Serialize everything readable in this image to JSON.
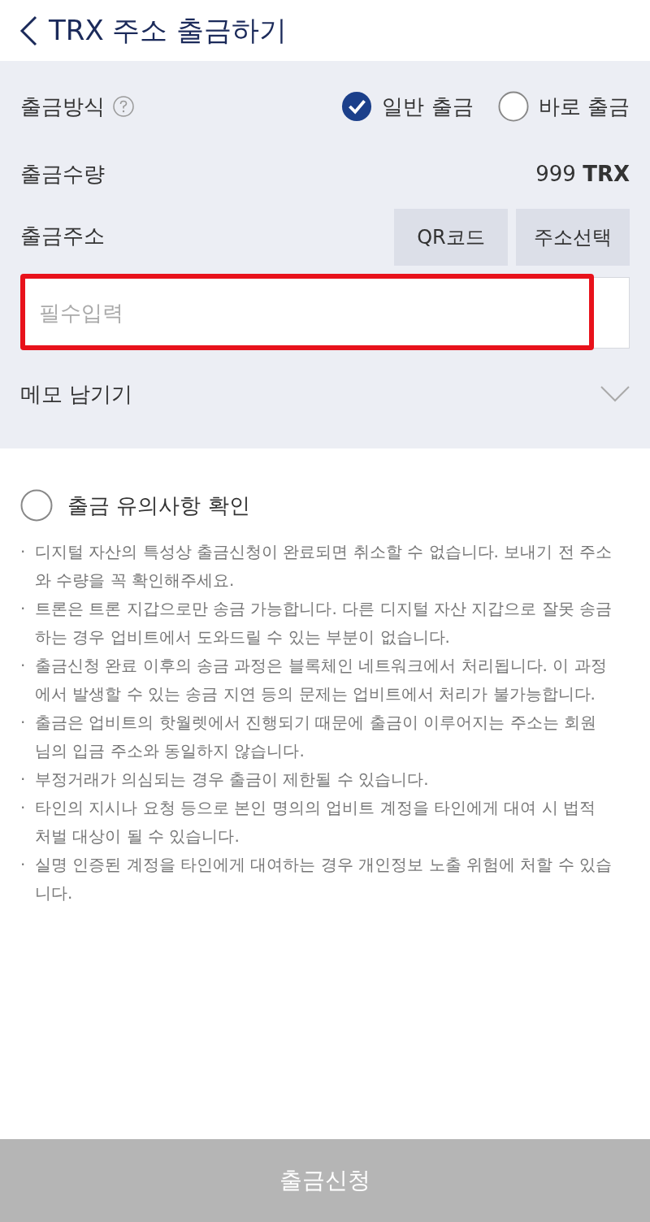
{
  "header": {
    "title": "TRX 주소 출금하기"
  },
  "method": {
    "label": "출금방식",
    "options": [
      {
        "label": "일반 출금",
        "selected": true
      },
      {
        "label": "바로 출금",
        "selected": false
      }
    ]
  },
  "amount": {
    "label": "출금수량",
    "value": "999",
    "unit": "TRX"
  },
  "address": {
    "label": "출금주소",
    "buttons": [
      "QR코드",
      "주소선택"
    ],
    "placeholder": "필수입력"
  },
  "memo": {
    "label": "메모 남기기",
    "expanded": false
  },
  "confirm": {
    "label": "출금 유의사항 확인",
    "checked": false
  },
  "notes": [
    {
      "bullet": "·",
      "text": "디지털 자산의 특성상 출금신청이 완료되면 취소할 수 없습니다. 보내기 전 주소와 수량을 꼭 확인해주세요."
    },
    {
      "bullet": "·",
      "text": "트론은 트론 지갑으로만 송금 가능합니다. 다른 디지털 자산 지갑으로 잘못 송금하는 경우 업비트에서 도와드릴 수 있는 부분이 없습니다."
    },
    {
      "bullet": "·",
      "text": "출금신청 완료 이후의 송금 과정은 블록체인 네트워크에서 처리됩니다. 이 과정에서 발생할 수 있는 송금 지연 등의 문제는 업비트에서 처리가 불가능합니다."
    },
    {
      "bullet": "·",
      "text": "출금은 업비트의 핫월렛에서 진행되기 때문에 출금이 이루어지는 주소는 회원님의 입금 주소와 동일하지 않습니다."
    },
    {
      "bullet": "·",
      "text": "부정거래가 의심되는 경우 출금이 제한될 수 있습니다."
    },
    {
      "bullet": "·",
      "text": "타인의 지시나 요청 등으로 본인 명의의 업비트 계정을 타인에게 대여 시 법적 처벌 대상이 될 수 있습니다."
    },
    {
      "bullet": "·",
      "text": "실명 인증된 계정을 타인에게 대여하는 경우 개인정보 노출 위험에 처할 수 있습니다."
    }
  ],
  "submit": {
    "label": "출금신청",
    "disabled": true
  }
}
